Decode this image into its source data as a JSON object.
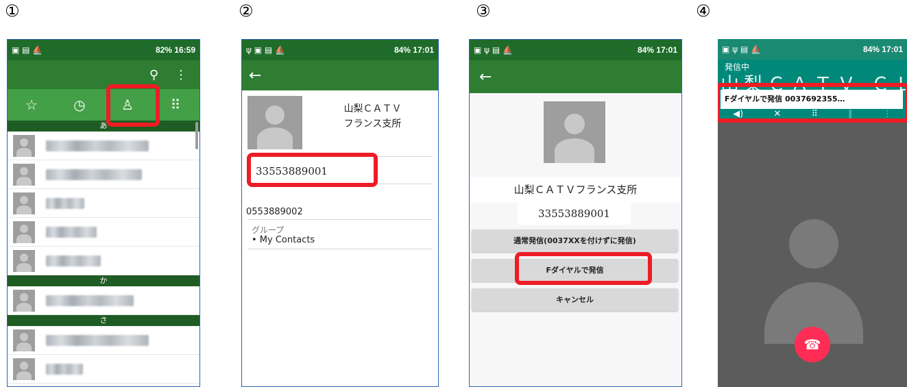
{
  "steps": [
    "①",
    "②",
    "③",
    "④"
  ],
  "phone1": {
    "status_right": "82% 16:59",
    "toolbar_icons": [
      "search-icon",
      "more-vert-icon"
    ],
    "tabs": [
      {
        "icon": "star-icon",
        "glyph": "☆"
      },
      {
        "icon": "clock-icon",
        "glyph": "◷"
      },
      {
        "icon": "contacts-icon",
        "glyph": "♙"
      },
      {
        "icon": "dialpad-icon",
        "glyph": "⠿"
      }
    ],
    "index_a": "あ",
    "index_ka": "か",
    "index_sa": "さ"
  },
  "phone2": {
    "status_right": "84% 17:01",
    "back": "←",
    "contact_name_line1": "山梨ＣＡＴＶ",
    "contact_name_line2": "フランス支所",
    "phone_number": "33553889001",
    "other_number": "0553889002",
    "group_label": "グループ",
    "group_value": "• My Contacts"
  },
  "phone3": {
    "status_right": "84% 17:01",
    "back": "←",
    "contact_name": "山梨ＣＡＴＶフランス支所",
    "phone_number": "33553889001",
    "btn_normal": "通常発信(0037XXを付けずに発信)",
    "btn_fdial": "Fダイヤルで発信",
    "btn_cancel": "キャンセル"
  },
  "phone4": {
    "status_right": "84% 17:01",
    "calling_label": "発信中",
    "call_name": "山梨ＣＡＴＶ ＣＬ",
    "banner": "Fダイヤルで発信 0037692355…"
  },
  "colors": {
    "highlight": "#ee1c25",
    "green_dark": "#1f6c2a",
    "green": "#2e7d32",
    "teal": "#00897b",
    "end_call": "#ff2d55"
  }
}
